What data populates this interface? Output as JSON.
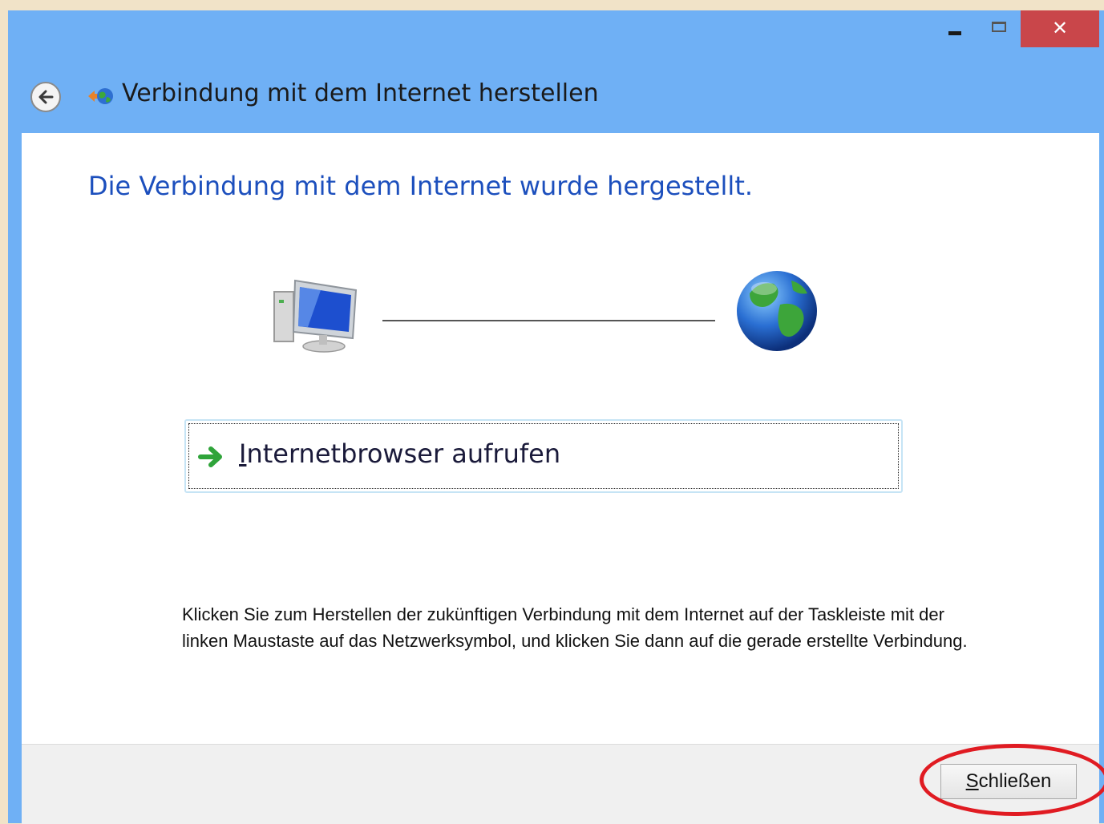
{
  "window": {
    "title": "Verbindung mit dem Internet herstellen",
    "controls": {
      "minimize": "minimize",
      "maximize": "maximize",
      "close_glyph": "✕"
    }
  },
  "main": {
    "heading": "Die Verbindung mit dem Internet wurde hergestellt.",
    "browser_link": {
      "label_first": "I",
      "label_rest": "nternetbrowser aufrufen"
    },
    "info_text": "Klicken Sie zum Herstellen der zukünftigen Verbindung mit dem Internet auf der Taskleiste mit der linken Maustaste auf das Netzwerksymbol, und klicken Sie dann auf die gerade erstellte Verbindung."
  },
  "footer": {
    "close_button": {
      "label_first": "S",
      "label_rest": "chließen"
    }
  },
  "icons": {
    "back": "back-arrow-icon",
    "title": "network-globe-icon",
    "computer": "computer-icon",
    "globe": "globe-icon",
    "link_arrow": "green-arrow-icon"
  },
  "colors": {
    "title_bar": "#6fb0f5",
    "close_control": "#c9464a",
    "heading": "#1c4fbd",
    "highlight_circle": "#e01b22"
  }
}
